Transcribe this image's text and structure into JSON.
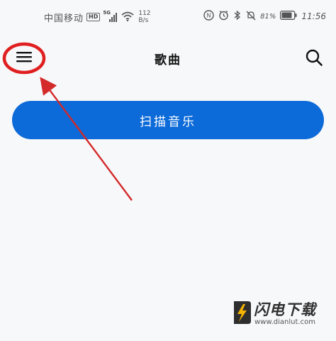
{
  "status_bar": {
    "carrier": "中国移动",
    "hd_label": "HD",
    "network_type": "5G",
    "speed_value": "112",
    "speed_unit": "B/s",
    "battery_percent": "81%",
    "time": "11:56"
  },
  "header": {
    "title": "歌曲"
  },
  "main": {
    "scan_button_label": "扫描音乐"
  },
  "watermark": {
    "brand": "闪电下载",
    "url": "www.dianlut.com"
  },
  "colors": {
    "accent": "#0c6ad9",
    "annotation": "#d42a2a",
    "background": "#f7f8fa"
  },
  "icons": {
    "menu": "hamburger-menu-icon",
    "search": "search-icon",
    "wifi": "wifi-icon",
    "signal": "signal-icon",
    "battery": "battery-icon",
    "alarm": "alarm-icon",
    "bluetooth": "bluetooth-icon",
    "mute": "mute-icon",
    "nfc": "nfc-icon"
  }
}
